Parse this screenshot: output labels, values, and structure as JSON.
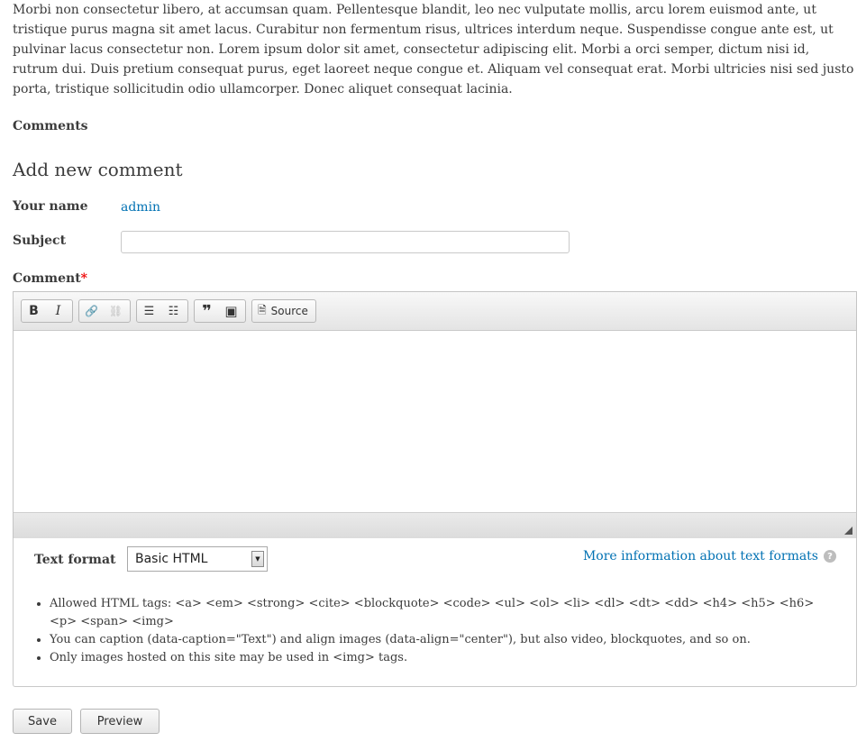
{
  "article": {
    "body": "Morbi non consectetur libero, at accumsan quam. Pellentesque blandit, leo nec vulputate mollis, arcu lorem euismod ante, ut tristique purus magna sit amet lacus. Curabitur non fermentum risus, ultrices interdum neque. Suspendisse congue ante est, ut pulvinar lacus consectetur non. Lorem ipsum dolor sit amet, consectetur adipiscing elit. Morbi a orci semper, dictum nisi id, rutrum dui. Duis pretium consequat purus, eget laoreet neque congue et. Aliquam vel consequat erat. Morbi ultricies nisi sed justo porta, tristique sollicitudin odio ullamcorper. Donec aliquet consequat lacinia."
  },
  "comments": {
    "heading": "Comments",
    "form_title": "Add new comment",
    "name_label": "Your name",
    "name_value": "admin",
    "subject_label": "Subject",
    "subject_value": "",
    "subject_placeholder": "",
    "comment_label": "Comment",
    "required_marker": "*"
  },
  "toolbar": {
    "bold": "B",
    "italic": "I",
    "link": "🔗",
    "unlink": "⛓",
    "bulleted_list": "☰",
    "numbered_list": "☷",
    "blockquote": "❞",
    "image": "▣",
    "source_label": "Source",
    "source_icon": "🗎"
  },
  "text_format": {
    "label": "Text format",
    "selected": "Basic HTML",
    "arrow": "▼",
    "more_info_link": "More information about text formats",
    "help_glyph": "?",
    "tips": [
      "Allowed HTML tags: <a> <em> <strong> <cite> <blockquote> <code> <ul> <ol> <li> <dl> <dt> <dd> <h4> <h5> <h6> <p> <span> <img>",
      "You can caption (data-caption=\"Text\") and align images (data-align=\"center\"), but also video, blockquotes, and so on.",
      "Only images hosted on this site may be used in <img> tags."
    ]
  },
  "actions": {
    "save": "Save",
    "preview": "Preview"
  }
}
